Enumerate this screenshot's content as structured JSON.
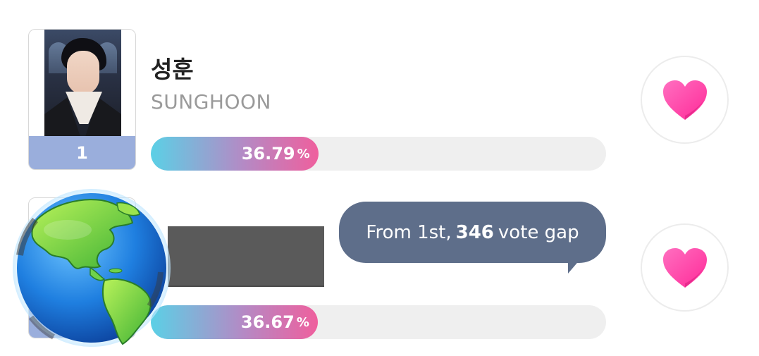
{
  "entries": [
    {
      "rank": "1",
      "name_ko": "성훈",
      "name_en": "SUNGHOON",
      "percent": "36.79",
      "percent_unit": "%",
      "share": 0.3679
    },
    {
      "percent": "36.67",
      "percent_unit": "%",
      "share": 0.3667,
      "gap_tooltip": {
        "prefix": "From 1st,",
        "gap_value": "346",
        "suffix": "vote gap"
      }
    }
  ],
  "colors": {
    "bar_start": "#5bd0e6",
    "bar_end": "#ef5f9d",
    "rank_badge": "#9aaedc",
    "tooltip_bg": "#5e6e8a",
    "heart": "#ff3fa3"
  },
  "icons": {
    "vote": "heart-icon",
    "overlay": "globe-icon"
  }
}
